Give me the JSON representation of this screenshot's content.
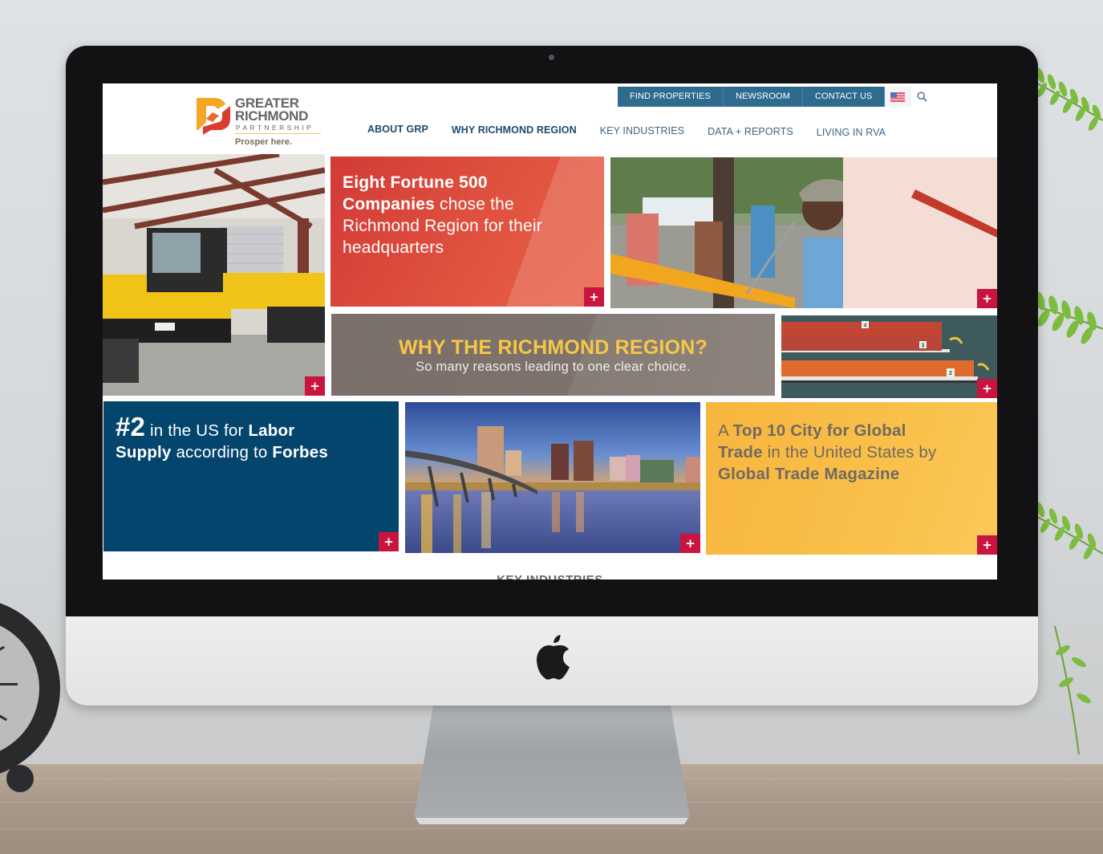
{
  "scene": {
    "device": "desktop monitor mockup",
    "logo_icon": "apple-logo-icon"
  },
  "header": {
    "logo": {
      "line1": "GREATER",
      "line2": "RICHMOND",
      "line3": "PARTNERSHIP",
      "tagline": "Prosper here.",
      "colors": {
        "orange": "#f4a624",
        "red": "#dc3b2f",
        "gray": "#6a6363"
      }
    },
    "utility_links": [
      {
        "label": "FIND PROPERTIES"
      },
      {
        "label": "NEWSROOM"
      },
      {
        "label": "CONTACT US"
      }
    ],
    "language_flag": "us-flag-icon",
    "search": "search-icon",
    "nav": [
      {
        "label": "ABOUT GRP"
      },
      {
        "label": "WHY RICHMOND REGION"
      },
      {
        "label": "KEY INDUSTRIES"
      },
      {
        "label": "DATA + REPORTS"
      },
      {
        "label": "LIVING IN RVA"
      }
    ],
    "utility_color": "#2f6b8f",
    "nav_color": "#1f4a6e"
  },
  "tiles": {
    "plus_label": "+",
    "plus_color": "#c8143f",
    "equipment_image": "Yellow tracked dump carriers in a warehouse",
    "fortune": {
      "bold1": "Eight Fortune 500",
      "bold2": "Companies",
      "rest1": " chose the",
      "rest2": "Richmond Region for their",
      "rest3": "headquarters",
      "color": "#d94338"
    },
    "music_image": "Street performer singing into microphone with crowd",
    "why": {
      "title": "WHY THE RICHMOND REGION?",
      "subtitle": "So many reasons leading to one clear choice.",
      "color": "#7c716b",
      "title_color": "#f7c746"
    },
    "dragon_image": "Dragon boat race on river",
    "dragon_numbers": [
      "4",
      "3",
      "2"
    ],
    "labor": {
      "big": "#2",
      "t1": " in the US for ",
      "b1": "Labor",
      "b2": "Supply",
      "t2": " according to ",
      "b3": "Forbes",
      "color": "#03456d"
    },
    "skyline_image": "Richmond skyline at dusk with bridge over the James River",
    "trade": {
      "t1": "A ",
      "b1": "Top 10 City for Global",
      "b2": "Trade",
      "t2": " in the United States by",
      "b3": "Global Trade Magazine",
      "color": "#f9bd47"
    }
  },
  "sections": {
    "next_heading": "KEY INDUSTRIES"
  }
}
